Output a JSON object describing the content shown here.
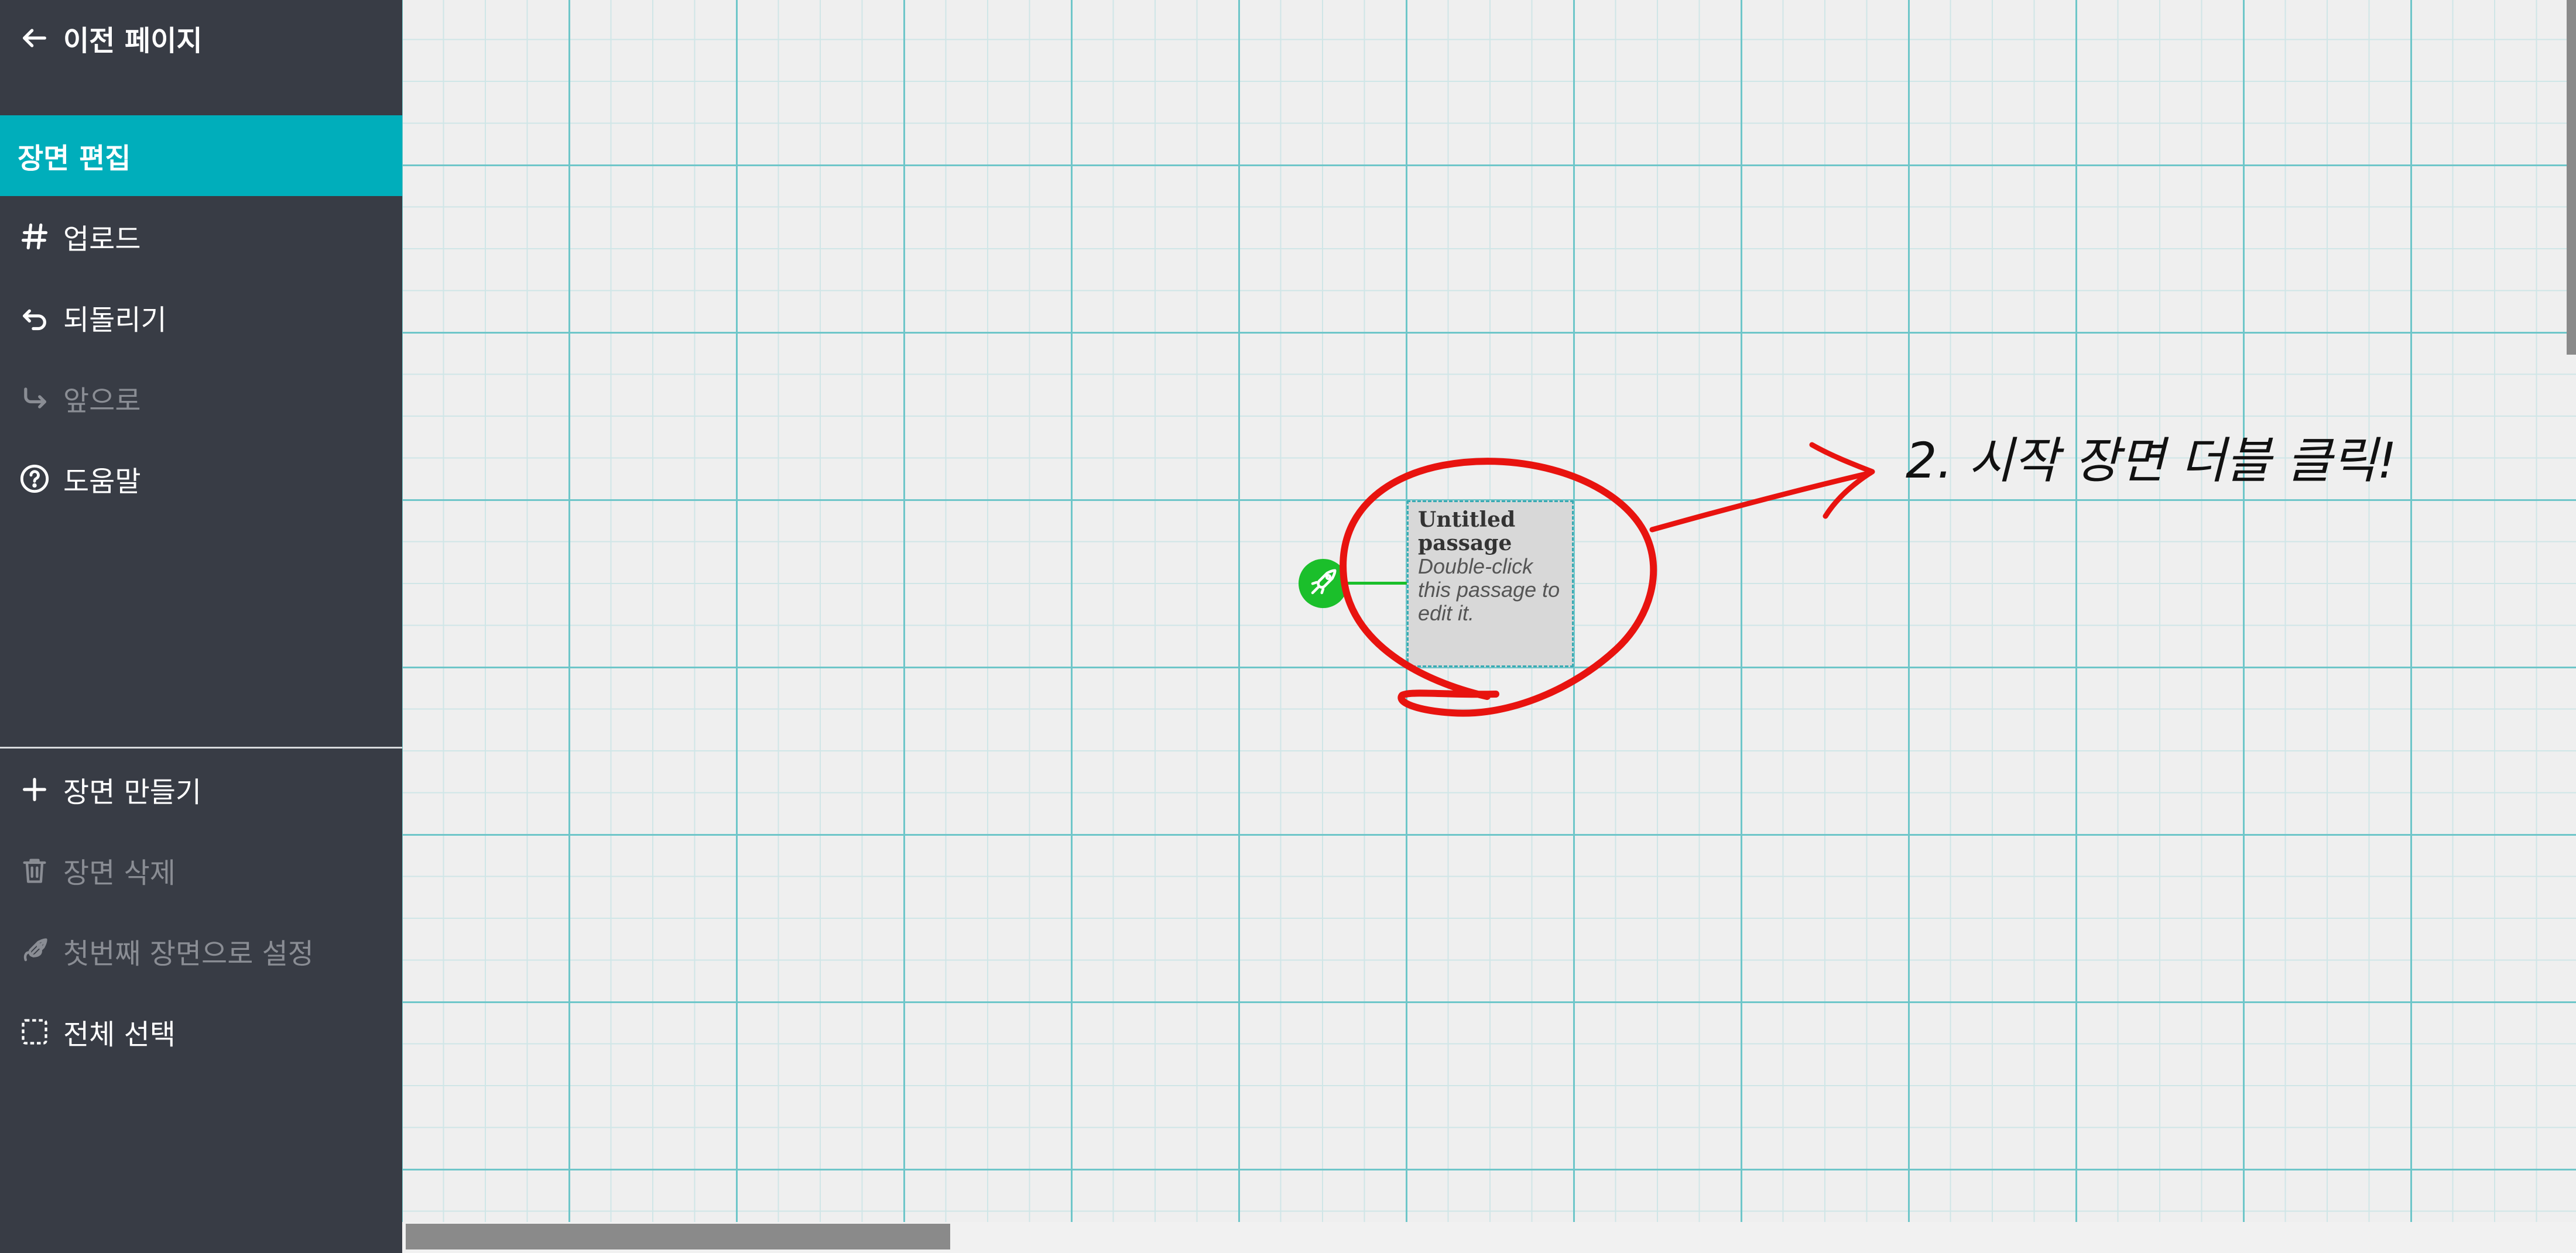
{
  "sidebar": {
    "back_label": "이전 페이지",
    "active_tab_label": "장면 편집",
    "top_items": [
      {
        "label": "업로드",
        "icon": "hash-icon",
        "enabled": true
      },
      {
        "label": "되돌리기",
        "icon": "undo-icon",
        "enabled": true
      },
      {
        "label": "앞으로",
        "icon": "redo-icon",
        "enabled": false
      },
      {
        "label": "도움말",
        "icon": "help-icon",
        "enabled": true
      }
    ],
    "bottom_items": [
      {
        "label": "장면 만들기",
        "icon": "plus-icon",
        "enabled": true
      },
      {
        "label": "장면 삭제",
        "icon": "trash-icon",
        "enabled": false
      },
      {
        "label": "첫번째 장면으로 설정",
        "icon": "rocket-icon",
        "enabled": false
      },
      {
        "label": "전체 선택",
        "icon": "select-all-icon",
        "enabled": true
      }
    ]
  },
  "passage": {
    "title": "Untitled passage",
    "excerpt": "Double-click this passage to edit it.",
    "is_start": true
  },
  "annotation": {
    "text": "2. 시작 장면 더블 클릭!",
    "color": "#e8130f"
  },
  "colors": {
    "sidebar_bg": "#383c45",
    "active_tab": "#00aebb",
    "start_badge": "#1bbf2b",
    "grid_major": "#6ec6c9"
  }
}
